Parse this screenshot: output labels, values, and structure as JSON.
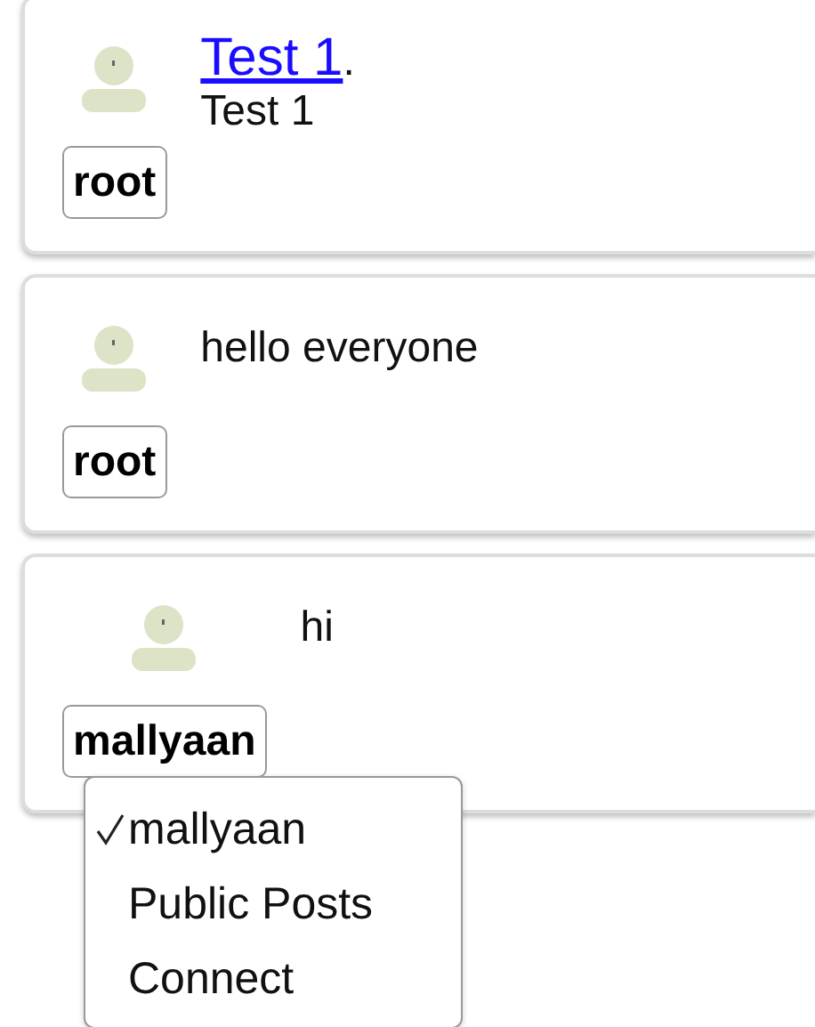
{
  "posts": [
    {
      "author": "root",
      "title": "Test 1",
      "title_suffix": ".",
      "body": "Test 1"
    },
    {
      "author": "root",
      "body": "hello everyone"
    },
    {
      "author": "mallyaan",
      "body": "hi",
      "menu": {
        "items": [
          {
            "label": "mallyaan",
            "selected": true
          },
          {
            "label": "Public Posts",
            "selected": false
          },
          {
            "label": "Connect",
            "selected": false
          }
        ]
      }
    }
  ]
}
